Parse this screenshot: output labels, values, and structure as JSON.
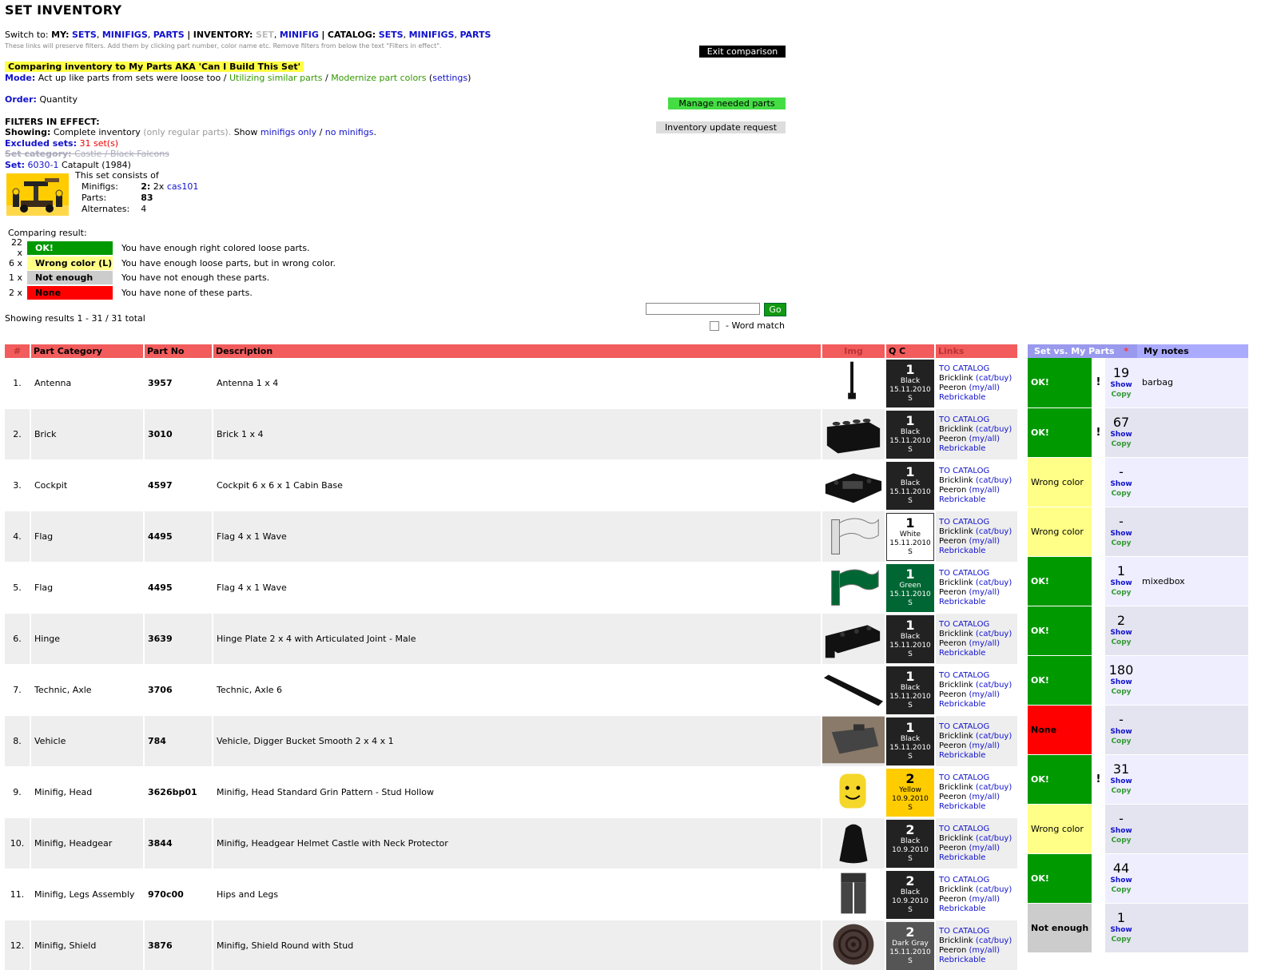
{
  "page_title": "SET INVENTORY",
  "switch": {
    "prefix": "Switch to:",
    "my_label": "MY:",
    "my_links": [
      "SETS",
      "MINIFIGS",
      "PARTS"
    ],
    "inv_label": "INVENTORY:",
    "inv_set": "SET",
    "inv_minifig": "MINIFIG",
    "cat_label": "CATALOG:",
    "cat_links": [
      "SETS",
      "MINIFIGS",
      "PARTS"
    ],
    "sep": "|"
  },
  "hint": "These links will preserve filters. Add them by clicking part number, color name etc. Remove filters from below the text \"Filters in effect\".",
  "highlight": "Comparing inventory to My Parts AKA 'Can I Build This Set'",
  "mode": {
    "label": "Mode:",
    "text1": "Act up like parts from sets were loose too",
    "sep": "/",
    "text2": "Utilizing similar parts",
    "text3": "Modernize part colors",
    "settings": "settings"
  },
  "order": {
    "label": "Order:",
    "value": "Quantity"
  },
  "filters_title": "FILTERS IN EFFECT:",
  "showing": {
    "label": "Showing:",
    "text": "Complete inventory",
    "gray": "(only regular parts).",
    "show": "Show",
    "link1": "minifigs only",
    "link2": "no minifigs"
  },
  "excluded": {
    "label": "Excluded sets:",
    "value": "31 set(s)"
  },
  "setcat": {
    "label": "Set category:",
    "value": "Castle / Black Falcons"
  },
  "setline": {
    "label": "Set:",
    "num": "6030-1",
    "name": "Catapult (1984)"
  },
  "consists": {
    "title": "This set consists of",
    "minifigs_label": "Minifigs:",
    "minifigs_value": "2:",
    "minifigs_text": "2x",
    "minifigs_link": "cas101",
    "parts_label": "Parts:",
    "parts_value": "83",
    "alt_label": "Alternates:",
    "alt_value": "4"
  },
  "buttons": {
    "exit": "Exit comparison",
    "manage": "Manage needed parts",
    "request": "Inventory update request",
    "go": "Go"
  },
  "comparing_title": "Comparing result:",
  "legend": [
    {
      "n": "22 x",
      "label": "OK!",
      "text": "You have enough right colored loose parts.",
      "bg": "#009900",
      "fg": "#ffffff"
    },
    {
      "n": "6 x",
      "label": "Wrong color (L)",
      "text": "You have enough loose parts, but in wrong color.",
      "bg": "#ffff88",
      "fg": "#000000"
    },
    {
      "n": "1 x",
      "label": "Not enough",
      "text": "You have not enough these parts.",
      "bg": "#cccccc",
      "fg": "#000000"
    },
    {
      "n": "2 x",
      "label": "None",
      "text": "You have none of these parts.",
      "bg": "#ff0000",
      "fg": "#000000"
    }
  ],
  "word_match": "- Word match",
  "results": "Showing results 1 - 31 / 31 total",
  "headers": {
    "num": "#",
    "cat": "Part Category",
    "pno": "Part No",
    "desc": "Description",
    "img": "Img",
    "qc": "Q C",
    "links": "Links",
    "setvs": "Set vs. My Parts",
    "star": "*",
    "notes": "My notes"
  },
  "link_labels": {
    "catalog": "TO CATALOG",
    "bricklink": "Bricklink",
    "bl_links": "(cat/buy)",
    "peeron": "Peeron",
    "pe_links": "(my/all)",
    "rebrickable": "Rebrickable",
    "show": "Show",
    "copy": "Copy"
  },
  "rows": [
    {
      "num": "1.",
      "cat": "Antenna",
      "pno": "3957",
      "desc": "Antenna 1 x 4",
      "icon": "antenna-image",
      "q": "1",
      "color": "Black",
      "date": "15.11.2010",
      "s": "S",
      "qbg": "#222222",
      "qfg": "#ffffff",
      "status": "OK!",
      "st": "ok",
      "ex": "!",
      "cnt": "19",
      "note": "barbag"
    },
    {
      "num": "2.",
      "cat": "Brick",
      "pno": "3010",
      "desc": "Brick 1 x 4",
      "icon": "brick-image",
      "q": "1",
      "color": "Black",
      "date": "15.11.2010",
      "s": "S",
      "qbg": "#222222",
      "qfg": "#ffffff",
      "status": "OK!",
      "st": "ok",
      "ex": "!",
      "cnt": "67",
      "note": ""
    },
    {
      "num": "3.",
      "cat": "Cockpit",
      "pno": "4597",
      "desc": "Cockpit 6 x 6 x 1 Cabin Base",
      "icon": "cockpit-image",
      "q": "1",
      "color": "Black",
      "date": "15.11.2010",
      "s": "S",
      "qbg": "#222222",
      "qfg": "#ffffff",
      "status": "Wrong color",
      "st": "wc",
      "ex": "",
      "cnt": "-",
      "note": ""
    },
    {
      "num": "4.",
      "cat": "Flag",
      "pno": "4495",
      "desc": "Flag 4 x 1 Wave",
      "icon": "flag-image",
      "q": "1",
      "color": "White",
      "date": "15.11.2010",
      "s": "S",
      "qbg": "#ffffff",
      "qfg": "#000000",
      "status": "Wrong color",
      "st": "wc",
      "ex": "",
      "cnt": "-",
      "note": ""
    },
    {
      "num": "5.",
      "cat": "Flag",
      "pno": "4495",
      "desc": "Flag 4 x 1 Wave",
      "icon": "flag-image",
      "q": "1",
      "color": "Green",
      "date": "15.11.2010",
      "s": "S",
      "qbg": "#006633",
      "qfg": "#ffffff",
      "status": "OK!",
      "st": "ok",
      "ex": "",
      "cnt": "1",
      "note": "mixedbox"
    },
    {
      "num": "6.",
      "cat": "Hinge",
      "pno": "3639",
      "desc": "Hinge Plate 2 x 4 with Articulated Joint - Male",
      "icon": "hinge-image",
      "q": "1",
      "color": "Black",
      "date": "15.11.2010",
      "s": "S",
      "qbg": "#222222",
      "qfg": "#ffffff",
      "status": "OK!",
      "st": "ok",
      "ex": "",
      "cnt": "2",
      "note": ""
    },
    {
      "num": "7.",
      "cat": "Technic, Axle",
      "pno": "3706",
      "desc": "Technic, Axle 6",
      "icon": "axle-image",
      "q": "1",
      "color": "Black",
      "date": "15.11.2010",
      "s": "S",
      "qbg": "#222222",
      "qfg": "#ffffff",
      "status": "OK!",
      "st": "ok",
      "ex": "",
      "cnt": "180",
      "note": ""
    },
    {
      "num": "8.",
      "cat": "Vehicle",
      "pno": "784",
      "desc": "Vehicle, Digger Bucket Smooth 2 x 4 x 1",
      "icon": "bucket-image",
      "q": "1",
      "color": "Black",
      "date": "15.11.2010",
      "s": "S",
      "qbg": "#222222",
      "qfg": "#ffffff",
      "status": "None",
      "st": "none",
      "ex": "",
      "cnt": "-",
      "note": ""
    },
    {
      "num": "9.",
      "cat": "Minifig, Head",
      "pno": "3626bp01",
      "desc": "Minifig, Head Standard Grin Pattern - Stud Hollow",
      "icon": "head-image",
      "q": "2",
      "color": "Yellow",
      "date": "10.9.2010",
      "s": "S",
      "qbg": "#ffcc00",
      "qfg": "#000000",
      "status": "OK!",
      "st": "ok",
      "ex": "!",
      "cnt": "31",
      "note": ""
    },
    {
      "num": "10.",
      "cat": "Minifig, Headgear",
      "pno": "3844",
      "desc": "Minifig, Headgear Helmet Castle with Neck Protector",
      "icon": "helmet-image",
      "q": "2",
      "color": "Black",
      "date": "10.9.2010",
      "s": "S",
      "qbg": "#222222",
      "qfg": "#ffffff",
      "status": "Wrong color",
      "st": "wc",
      "ex": "",
      "cnt": "-",
      "note": ""
    },
    {
      "num": "11.",
      "cat": "Minifig, Legs Assembly",
      "pno": "970c00",
      "desc": "Hips and Legs",
      "icon": "legs-image",
      "q": "2",
      "color": "Black",
      "date": "10.9.2010",
      "s": "S",
      "qbg": "#222222",
      "qfg": "#ffffff",
      "status": "OK!",
      "st": "ok",
      "ex": "",
      "cnt": "44",
      "note": ""
    },
    {
      "num": "12.",
      "cat": "Minifig, Shield",
      "pno": "3876",
      "desc": "Minifig, Shield Round with Stud",
      "icon": "shield-image",
      "q": "2",
      "color": "Dark Gray",
      "date": "15.11.2010",
      "s": "S",
      "qbg": "#555555",
      "qfg": "#ffffff",
      "status": "Not enough",
      "st": "ne",
      "ex": "",
      "cnt": "1",
      "note": ""
    }
  ]
}
